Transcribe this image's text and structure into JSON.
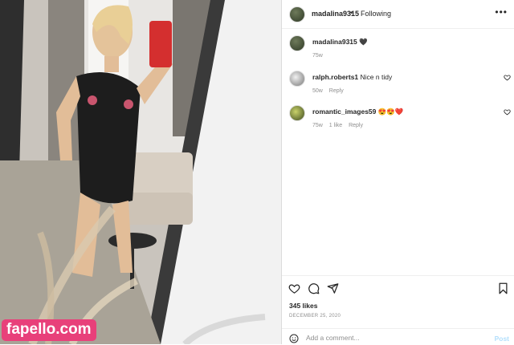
{
  "watermark": "fapello.com",
  "post": {
    "username": "madalina9315",
    "separator": "•",
    "follow_status": "Following",
    "caption": {
      "username": "madalina9315",
      "text": "🖤",
      "age": "75w"
    },
    "comments": [
      {
        "username": "ralph.roberts1",
        "text": "Nice n tidy",
        "age": "50w",
        "likes": "",
        "reply_label": "Reply"
      },
      {
        "username": "romantic_images59",
        "text": "😍😍❤️",
        "age": "75w",
        "likes": "1 like",
        "reply_label": "Reply"
      }
    ],
    "likes": "345 likes",
    "date": "DECEMBER 25, 2020",
    "add_comment_placeholder": "Add a comment...",
    "post_button": "Post"
  },
  "icons": [
    "more-icon",
    "like-icon",
    "comment-icon",
    "share-icon",
    "save-icon",
    "emoji-icon",
    "heart-small-icon"
  ],
  "colors": {
    "watermark_bg": "#e8407a",
    "post_button": "#b2dffc",
    "meta_text": "#8e8e8e",
    "text": "#262626"
  }
}
